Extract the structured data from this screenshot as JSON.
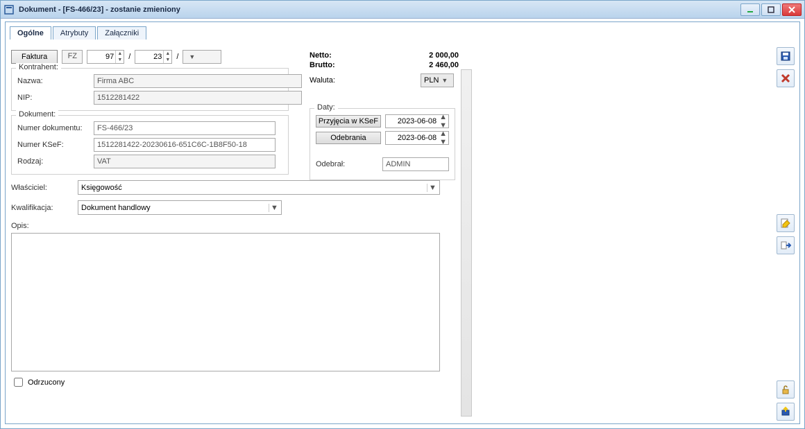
{
  "window": {
    "title": "Dokument - [FS-466/23] - zostanie zmieniony"
  },
  "tabs": [
    {
      "label": "Ogólne",
      "active": true
    },
    {
      "label": "Atrybuty",
      "active": false
    },
    {
      "label": "Załączniki",
      "active": false
    }
  ],
  "header": {
    "faktura_btn": "Faktura",
    "type_code": "FZ",
    "num1": "97",
    "num2": "23",
    "sep": "/",
    "num3": ""
  },
  "kontrahent": {
    "legend": "Kontrahent:",
    "nazwa_lbl": "Nazwa:",
    "nazwa_val": "Firma ABC",
    "nip_lbl": "NIP:",
    "nip_val": "1512281422"
  },
  "dokument": {
    "legend": "Dokument:",
    "numer_lbl": "Numer dokumentu:",
    "numer_val": "FS-466/23",
    "ksef_lbl": "Numer KSeF:",
    "ksef_val": "1512281422-20230616-651C6C-1B8F50-18",
    "rodzaj_lbl": "Rodzaj:",
    "rodzaj_val": "VAT"
  },
  "totals": {
    "netto_lbl": "Netto:",
    "netto_val": "2 000,00",
    "brutto_lbl": "Brutto:",
    "brutto_val": "2 460,00",
    "waluta_lbl": "Waluta:",
    "waluta_val": "PLN"
  },
  "dates": {
    "legend": "Daty:",
    "przyjecia_btn": "Przyjęcia w KSeF",
    "przyjecia_val": "2023-06-08",
    "odebrania_btn": "Odebrania",
    "odebrania_val": "2023-06-08",
    "odebral_lbl": "Odebrał:",
    "odebral_val": "ADMIN"
  },
  "owner": {
    "wlasciciel_lbl": "Właściciel:",
    "wlasciciel_val": "Księgowość",
    "kwalifikacja_lbl": "Kwalifikacja:",
    "kwalifikacja_val": "Dokument handlowy"
  },
  "opis": {
    "lbl": "Opis:",
    "val": ""
  },
  "rejected": {
    "lbl": "Odrzucony",
    "checked": false
  }
}
